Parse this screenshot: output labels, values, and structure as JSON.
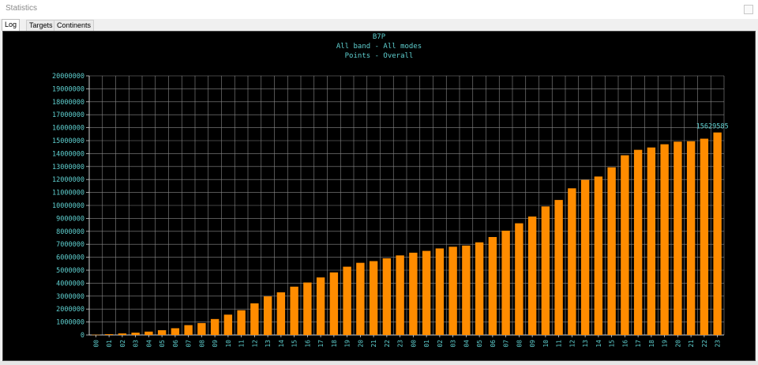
{
  "window": {
    "title": "Statistics"
  },
  "tabs": [
    {
      "label": "Log",
      "active": true
    },
    {
      "label": "Targets",
      "active": false
    },
    {
      "label": "Continents",
      "active": false
    }
  ],
  "chart_data": {
    "type": "bar",
    "title": "B7P",
    "subtitle": "All band - All modes",
    "subtitle2": "Points - Overall",
    "categories": [
      "00",
      "01",
      "02",
      "03",
      "04",
      "05",
      "06",
      "07",
      "08",
      "09",
      "10",
      "11",
      "12",
      "13",
      "14",
      "15",
      "16",
      "17",
      "18",
      "19",
      "20",
      "21",
      "22",
      "23",
      "00",
      "01",
      "02",
      "03",
      "04",
      "05",
      "06",
      "07",
      "08",
      "09",
      "10",
      "11",
      "12",
      "13",
      "14",
      "15",
      "16",
      "17",
      "18",
      "19",
      "20",
      "21",
      "22",
      "23"
    ],
    "values": [
      20000,
      60000,
      120000,
      180000,
      260000,
      370000,
      520000,
      760000,
      920000,
      1230000,
      1570000,
      1910000,
      2440000,
      2980000,
      3290000,
      3730000,
      4050000,
      4440000,
      4830000,
      5270000,
      5570000,
      5700000,
      5920000,
      6140000,
      6350000,
      6490000,
      6680000,
      6810000,
      6900000,
      7150000,
      7560000,
      8050000,
      8620000,
      9140000,
      9920000,
      10420000,
      11320000,
      11970000,
      12230000,
      12940000,
      13870000,
      14290000,
      14470000,
      14720000,
      14920000,
      14950000,
      15150000,
      15629585
    ],
    "ylim": [
      0,
      20000000
    ],
    "yticks": [
      "0",
      "1000000",
      "2000000",
      "3000000",
      "4000000",
      "5000000",
      "6000000",
      "7000000",
      "8000000",
      "9000000",
      "10000000",
      "11000000",
      "12000000",
      "13000000",
      "14000000",
      "15000000",
      "16000000",
      "17000000",
      "18000000",
      "19000000",
      "20000000"
    ],
    "annotation": "15629585",
    "grid": true,
    "colors": {
      "bar": "#ff8c00",
      "grid": "#8a8a8a",
      "text": "#5fd0d0",
      "axis": "#d0d0d0"
    }
  }
}
